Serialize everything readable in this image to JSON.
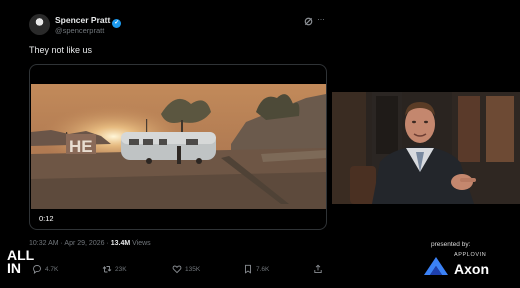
{
  "tweet": {
    "display_name": "Spencer Pratt",
    "handle": "@spencerpratt",
    "verified": true,
    "text": "They not like us",
    "video_time": "0:12",
    "timestamp": "10:32 AM · Apr 29, 2026 · ",
    "views_count": "13.4M",
    "views_label": " Views",
    "actions": {
      "replies": "4.7K",
      "reposts": "23K",
      "likes": "135K",
      "bookmarks": "7.6K"
    }
  },
  "overlay": {
    "logo_line1": "ALL",
    "logo_line2": "IN",
    "sponsor_label": "presented by:",
    "sponsor_small": "APPLOVIN",
    "sponsor_name": "Axon"
  },
  "colors": {
    "background": "#000000",
    "text": "#e7e9ea",
    "muted": "#71767b",
    "verified": "#1d9bf0"
  }
}
